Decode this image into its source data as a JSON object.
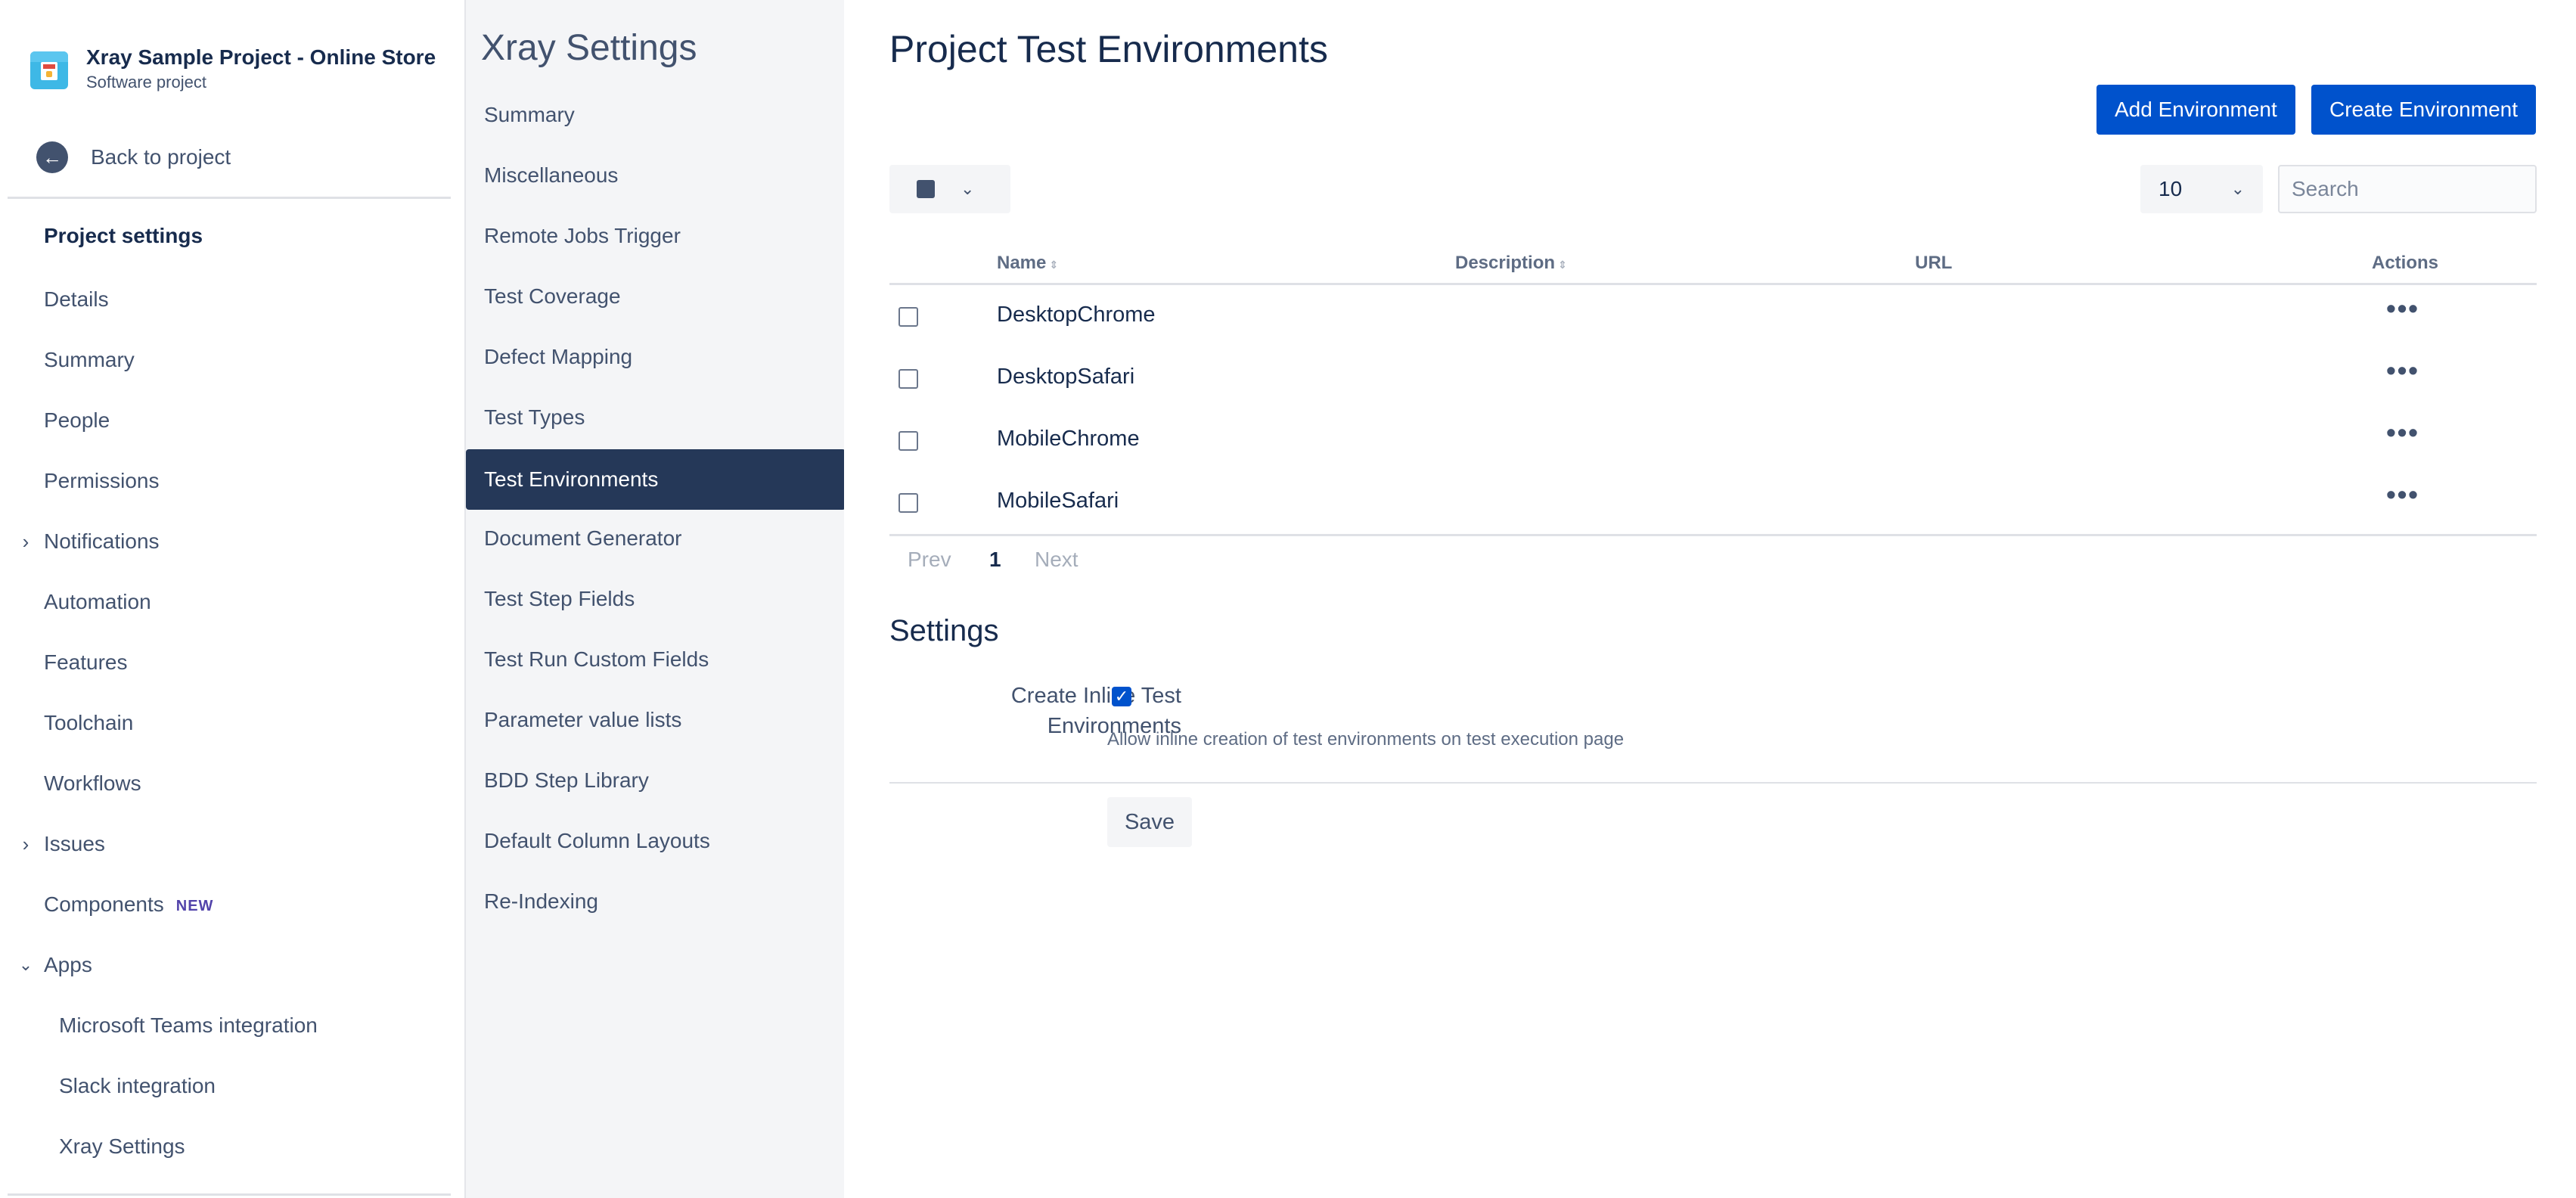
{
  "project": {
    "name": "Xray Sample Project - Online Store",
    "type": "Software project",
    "back_label": "Back to project"
  },
  "sidebar": {
    "heading": "Project settings",
    "items": [
      {
        "label": "Details"
      },
      {
        "label": "Summary"
      },
      {
        "label": "People"
      },
      {
        "label": "Permissions"
      },
      {
        "label": "Notifications",
        "expandable": "collapsed"
      },
      {
        "label": "Automation"
      },
      {
        "label": "Features"
      },
      {
        "label": "Toolchain"
      },
      {
        "label": "Workflows"
      },
      {
        "label": "Issues",
        "expandable": "collapsed"
      },
      {
        "label": "Components",
        "badge": "NEW"
      },
      {
        "label": "Apps",
        "expandable": "expanded"
      }
    ],
    "apps": [
      {
        "label": "Microsoft Teams integration"
      },
      {
        "label": "Slack integration"
      },
      {
        "label": "Xray Settings"
      }
    ]
  },
  "xray_nav": {
    "title": "Xray Settings",
    "items": [
      {
        "label": "Summary"
      },
      {
        "label": "Miscellaneous"
      },
      {
        "label": "Remote Jobs Trigger"
      },
      {
        "label": "Test Coverage"
      },
      {
        "label": "Defect Mapping"
      },
      {
        "label": "Test Types"
      },
      {
        "label": "Test Environments",
        "active": true
      },
      {
        "label": "Document Generator"
      },
      {
        "label": "Test Step Fields"
      },
      {
        "label": "Test Run Custom Fields"
      },
      {
        "label": "Parameter value lists"
      },
      {
        "label": "BDD Step Library"
      },
      {
        "label": "Default Column Layouts"
      },
      {
        "label": "Re-Indexing"
      }
    ]
  },
  "main": {
    "title": "Project Test Environments",
    "add_button": "Add Environment",
    "create_button": "Create Environment",
    "page_size": "10",
    "search_placeholder": "Search",
    "table": {
      "columns": [
        "Name",
        "Description",
        "URL",
        "Actions"
      ],
      "rows": [
        {
          "name": "DesktopChrome",
          "description": "",
          "url": ""
        },
        {
          "name": "DesktopSafari",
          "description": "",
          "url": ""
        },
        {
          "name": "MobileChrome",
          "description": "",
          "url": ""
        },
        {
          "name": "MobileSafari",
          "description": "",
          "url": ""
        }
      ]
    },
    "pagination": {
      "prev": "Prev",
      "current": "1",
      "next": "Next"
    },
    "settings": {
      "title": "Settings",
      "inline_label": "Create Inline Test Environments",
      "inline_checked": true,
      "inline_desc": "Allow inline creation of test environments on test execution page",
      "save_label": "Save"
    }
  },
  "colors": {
    "primary": "#0052cc",
    "active_nav": "#253858",
    "text": "#172b4d",
    "muted": "#42526e"
  }
}
